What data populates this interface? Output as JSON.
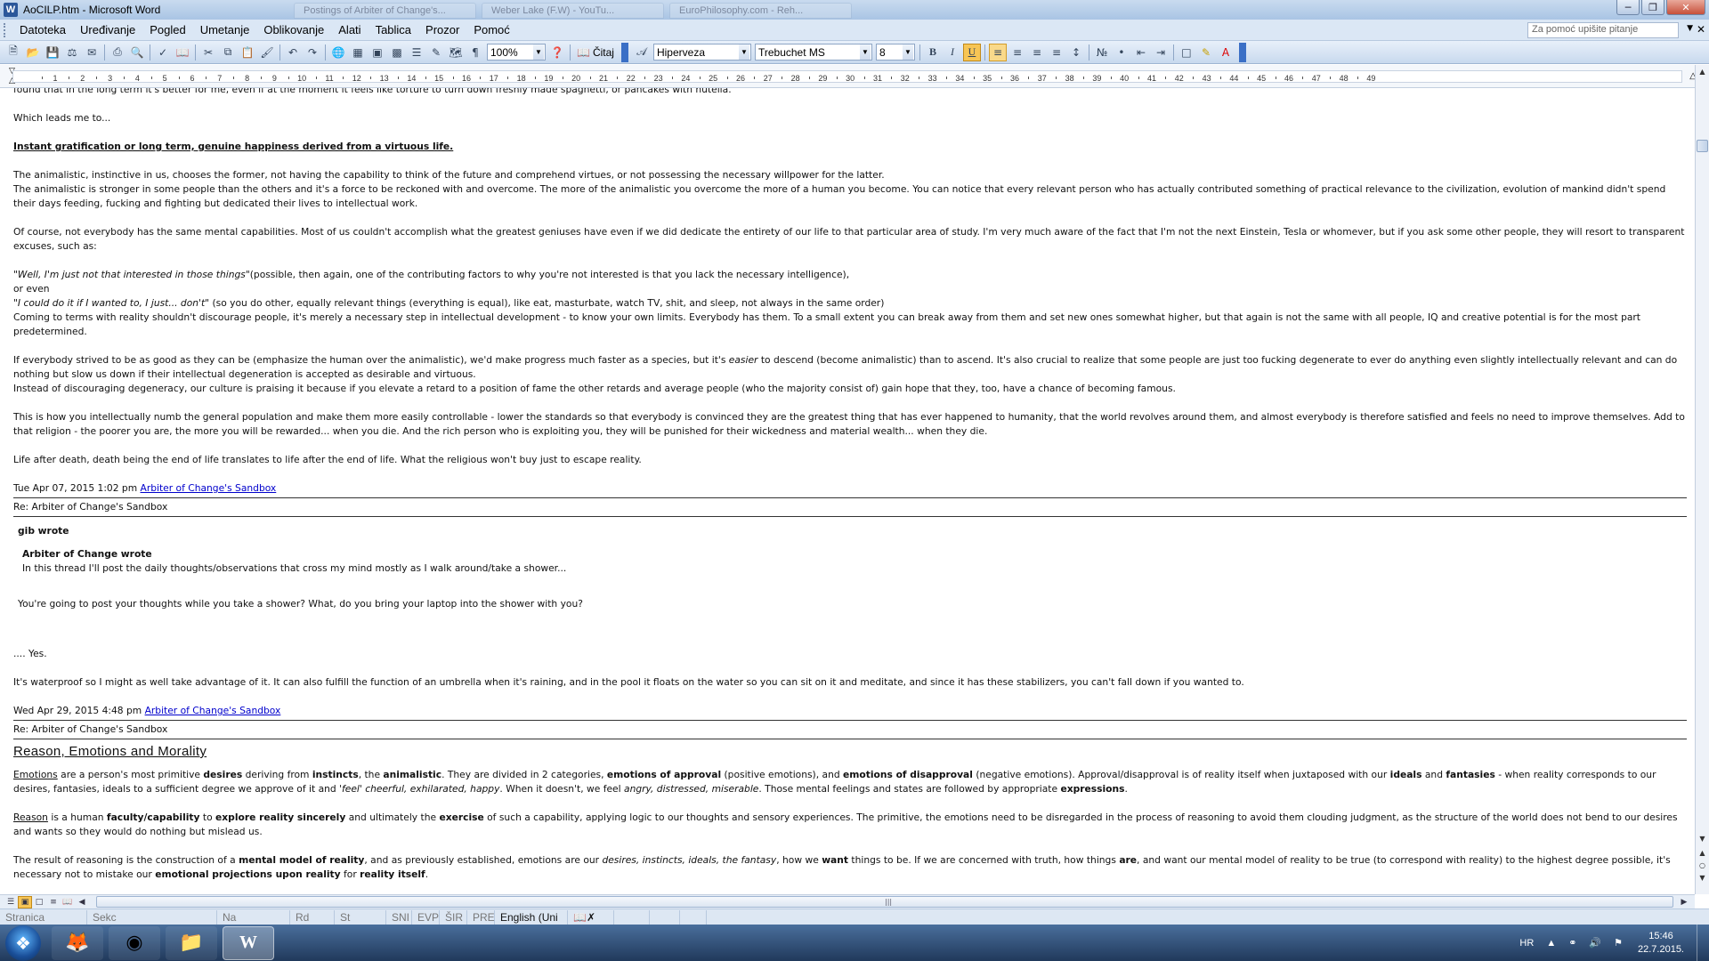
{
  "window": {
    "title": "AoCILP.htm - Microsoft Word",
    "app_icon": "W",
    "ghost_tabs": [
      "Postings of Arbiter of Change's...",
      "Weber Lake (F.W) - YouTu...",
      "EuroPhilosophy.com - Reh..."
    ]
  },
  "menu": [
    "Datoteka",
    "Uređivanje",
    "Pogled",
    "Umetanje",
    "Oblikovanje",
    "Alati",
    "Tablica",
    "Prozor",
    "Pomoć"
  ],
  "help_placeholder": "Za pomoć upišite pitanje",
  "toolbar": {
    "zoom": "100%",
    "read_label": "Čitaj",
    "style": "Hiperveza",
    "font": "Trebuchet MS",
    "size": "8",
    "bold": "B",
    "italic": "I",
    "underline": "U"
  },
  "ruler": {
    "numbers": [
      "1",
      "2",
      "3",
      "4",
      "5",
      "6",
      "7",
      "8",
      "9",
      "10",
      "11",
      "12",
      "13",
      "14",
      "15",
      "16",
      "17",
      "18",
      "19",
      "20",
      "21",
      "22",
      "23",
      "24",
      "25",
      "26",
      "27",
      "28",
      "29",
      "30",
      "31",
      "32",
      "33",
      "34",
      "35",
      "36",
      "37",
      "38",
      "39",
      "40",
      "41",
      "42",
      "43",
      "44",
      "45",
      "46",
      "47",
      "48",
      "49"
    ]
  },
  "doc": {
    "p0": "found that in the long term it's better for me, even if at the moment it feels like torture to turn down freshly made spaghetti, or pancakes with nutella.",
    "p1": "Which leads me to...",
    "h1": "Instant gratification or long term, genuine happiness derived from a virtuous life.",
    "p2a": "The animalistic, instinctive in us, chooses the former, not having the capability to think of the future and comprehend virtues, or not possessing the necessary willpower for the latter.",
    "p2b": "The animalistic is stronger in some people than the others and it's a force to be reckoned with and overcome. The more of the animalistic you overcome the more of a human you become. You can notice that every relevant person who has actually contributed something of practical relevance to the civilization, evolution of mankind didn't spend their days feeding, fucking and fighting but dedicated their lives to intellectual work.",
    "p3": "Of course, not everybody has the same mental capabilities. Most of us couldn't accomplish what the greatest geniuses have even if we did dedicate the entirety of our life to that particular area of study. I'm very much aware of the fact that I'm not the next Einstein, Tesla or whomever, but if you ask some other people, they will resort to transparent excuses, such as:",
    "q1_italic": "\"Well, I'm just not that interested in those things\"",
    "q1_rest": "(possible, then again, one of the contributing factors to why you're not interested is that you lack the necessary intelligence),",
    "or_even": "or even",
    "q2_italic": "\"I could do it if I wanted to, I just... don't\"",
    "q2_rest": " (so you do other, equally relevant things (everything is equal), like eat, masturbate, watch TV, shit, and sleep, not always in the same order)",
    "p4": "Coming to terms with reality shouldn't discourage people, it's merely a necessary step in intellectual development - to know your own limits. Everybody has them. To a small extent you can break away from them and set new ones somewhat higher, but that again is not the same with all people, IQ and creative potential is for the most part predetermined.",
    "p5a_1": "If everybody strived to be as good as they can be (emphasize the human over the animalistic), we'd make progress much faster as a species, but it's ",
    "p5a_em": "easier",
    "p5a_2": " to descend (become animalistic) than to ascend. It's also crucial to realize that some people are just too fucking degenerate to ever do anything even slightly intellectually relevant and can do nothing but slow us down if their intellectual degeneration is accepted as desirable and virtuous.",
    "p5b": "Instead of discouraging degeneracy, our culture is praising it because if you elevate a retard to a position of fame the other retards and average people (who the majority consist of) gain hope that they, too, have a chance of becoming famous.",
    "p6": "This is how you intellectually numb the general population and make them more easily controllable - lower the standards so that everybody is convinced they are the greatest thing that has ever happened to humanity, that the world revolves around them, and almost everybody is therefore satisfied and feels no need to improve themselves. Add to that religion - the poorer you are, the more you will be rewarded... when you die. And the rich person who is exploiting you, they will be punished for their wickedness and material wealth... when they die.",
    "p7": "Life after death, death being the end of life translates to life after the end of life. What the religious won't buy just to escape reality.",
    "sig1_date": "Tue Apr 07, 2015 1:02 pm ",
    "sig1_link": "Arbiter of Change's Sandbox",
    "re1": "Re: Arbiter of Change's Sandbox",
    "gib_wrote": "gib wrote",
    "aoc_wrote": "Arbiter of Change wrote",
    "aoc_quote": "In this thread I'll post the daily thoughts/observations that cross my mind mostly as I walk around/take a shower...",
    "gib_reply": "You're going to post your thoughts while you take a shower? What, do you bring your laptop into the shower with you?",
    "yes": ".... Yes.",
    "p8": "It's waterproof so I might as well take advantage of it. It can also fulfill the function of an umbrella when it's raining, and in the pool it floats on the water so you can sit on it and meditate, and since it has these stabilizers, you can't fall down if you wanted to.",
    "sig2_date": "Wed Apr 29, 2015 4:48 pm ",
    "sig2_link": "Arbiter of Change's Sandbox",
    "re2": "Re: Arbiter of Change's Sandbox",
    "title2": "Reason, Emotions and Morality",
    "e_emotions": "Emotions",
    "e_1": " are a person's most primitive ",
    "e_desires": "desires",
    "e_2": " deriving from ",
    "e_instincts": "instincts",
    "e_3": ", the ",
    "e_animalistic": "animalistic",
    "e_4": ". They are divided in 2 categories, ",
    "e_approval": "emotions of approval",
    "e_5": " (positive emotions), and ",
    "e_disapproval": "emotions of disapproval",
    "e_6": " (negative emotions). Approval/disapproval is of reality itself when juxtaposed with our ",
    "e_ideals": "ideals",
    "e_7": " and ",
    "e_fantasies": "fantasies",
    "e_8": " - when reality corresponds to our desires, fantasies, ideals to a sufficient degree we approve of it and ",
    "e_feel": "'feel' cheerful, exhilarated, happy",
    "e_9": ". When it doesn't, we feel ",
    "e_angry": "angry, distressed, miserable",
    "e_10": ". Those mental feelings and states are followed by appropriate ",
    "e_expr": "expressions",
    "e_11": ".",
    "r_reason": "Reason",
    "r_1": " is a human ",
    "r_fac": "faculty/capability",
    "r_2": " to ",
    "r_explore": "explore reality sincerely",
    "r_3": " and ultimately the ",
    "r_exercise": "exercise",
    "r_4": " of such a capability, applying logic to our thoughts and sensory experiences. The primitive, the emotions need to be disregarded in the process of reasoning to avoid them clouding judgment, as the structure of the world does not bend to our desires and wants so they would do nothing but mislead us.",
    "m_1": "The result of reasoning is the construction of a ",
    "m_model": "mental model of reality",
    "m_2": ", and as previously established, emotions are our ",
    "m_desires": "desires, instincts, ideals, the fantasy",
    "m_3": ", how we ",
    "m_want": "want",
    "m_4": " things to be. If we are concerned with truth, how things ",
    "m_are": "are",
    "m_5": ", and want our mental model of reality to be true (to correspond with reality) to the highest degree possible, it's necessary not to mistake our ",
    "m_proj": "emotional projections upon reality",
    "m_6": " for ",
    "m_itself": "reality itself",
    "m_7": "."
  },
  "status": {
    "page": "Stranica",
    "section": "Sekc",
    "at": "Na",
    "line": "Rd",
    "col": "St",
    "rec": "SNI",
    "trk": "EVP",
    "ext": "ŠIR",
    "ovr": "PRE",
    "lang": "English (Uni"
  },
  "tray": {
    "lang": "HR",
    "time": "15:46",
    "date": "22.7.2015."
  }
}
